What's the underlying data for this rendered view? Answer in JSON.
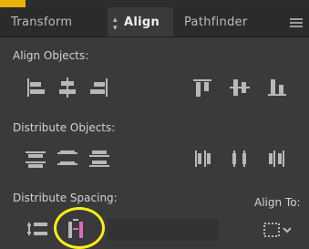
{
  "tabs": [
    {
      "label": "Transform",
      "active": false
    },
    {
      "label": "Align",
      "active": true
    },
    {
      "label": "Pathfinder",
      "active": false
    }
  ],
  "sections": {
    "align_objects": "Align Objects:",
    "distribute_objects": "Distribute Objects:",
    "distribute_spacing": "Distribute Spacing:",
    "align_to": "Align To:"
  },
  "icons": {
    "align_objects": [
      "horizontal-align-left-icon",
      "horizontal-align-center-icon",
      "horizontal-align-right-icon",
      "vertical-align-top-icon",
      "vertical-align-center-icon",
      "vertical-align-bottom-icon"
    ],
    "distribute_objects": [
      "vertical-distribute-top-icon",
      "vertical-distribute-center-icon",
      "vertical-distribute-bottom-icon",
      "horizontal-distribute-left-icon",
      "horizontal-distribute-center-icon",
      "horizontal-distribute-right-icon"
    ],
    "distribute_spacing": [
      "vertical-distribute-space-icon",
      "horizontal-distribute-space-icon"
    ],
    "align_to": [
      "align-to-selection-icon"
    ]
  },
  "colors": {
    "panel_bg": "#3a3a3a",
    "tab_bar_bg": "#2b2b2b",
    "icon_fill": "#b8b8b8",
    "highlight_circle": "#ffee1a",
    "accent": "#e8b20a",
    "icon_magenta": "#d56cbf"
  }
}
